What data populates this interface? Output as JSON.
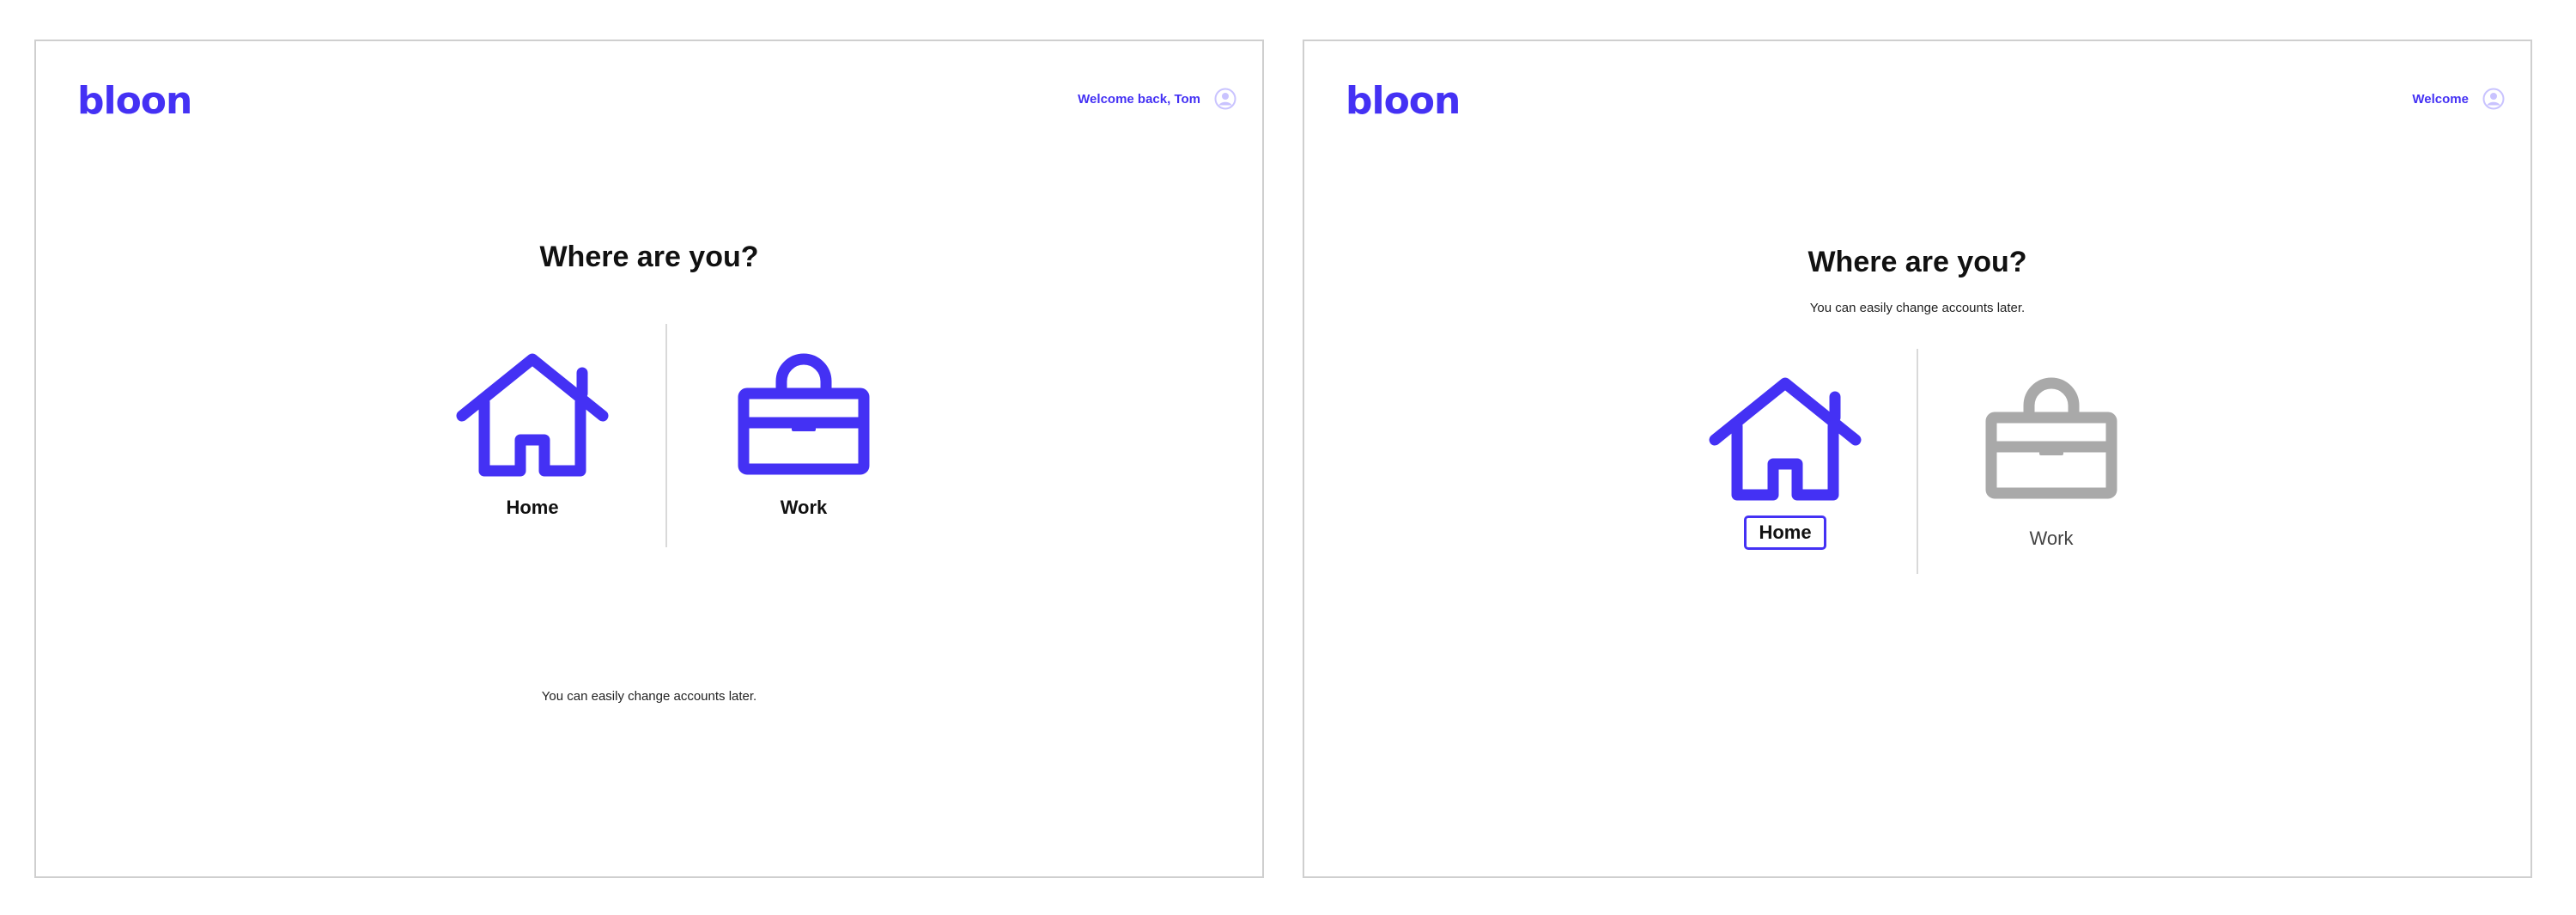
{
  "screens": [
    {
      "logo": "bloon",
      "welcome_text": "Welcome back, Tom",
      "heading": "Where are you?",
      "subtext": "You can easily change accounts later.",
      "options": [
        {
          "label": "Home",
          "icon": "home-icon",
          "color": "#4431f4",
          "state": "default"
        },
        {
          "label": "Work",
          "icon": "briefcase-icon",
          "color": "#4431f4",
          "state": "default"
        }
      ]
    },
    {
      "logo": "bloon",
      "welcome_text": "Welcome",
      "heading": "Where are you?",
      "subtext": "You can easily change accounts later.",
      "options": [
        {
          "label": "Home",
          "icon": "home-icon",
          "color": "#4431f4",
          "state": "focused"
        },
        {
          "label": "Work",
          "icon": "briefcase-icon",
          "color": "#a9a9a9",
          "state": "inactive"
        }
      ]
    }
  ],
  "colors": {
    "brand": "#4431f4",
    "inactive": "#a9a9a9",
    "divider": "#d9d9d9",
    "avatar": "#c9c3ff"
  }
}
